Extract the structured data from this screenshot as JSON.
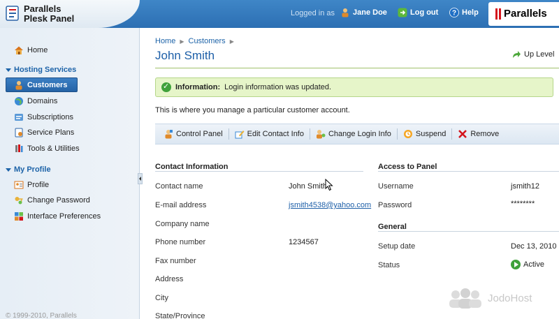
{
  "header": {
    "logo_line1": "Parallels",
    "logo_line2": "Plesk Panel",
    "logged_in_as": "Logged in as",
    "user_name": "Jane Doe",
    "logout_label": "Log out",
    "help_label": "Help",
    "brand": "Parallels"
  },
  "sidebar": {
    "home": "Home",
    "hosting_section": "Hosting Services",
    "hosting_items": [
      "Customers",
      "Domains",
      "Subscriptions",
      "Service Plans",
      "Tools & Utilities"
    ],
    "profile_section": "My Profile",
    "profile_items": [
      "Profile",
      "Change Password",
      "Interface Preferences"
    ],
    "copyright": "© 1999-2010, Parallels"
  },
  "breadcrumb": [
    "Home",
    "Customers"
  ],
  "page_title": "John Smith",
  "up_level": "Up Level",
  "info": {
    "label": "Information:",
    "text": "Login information was updated."
  },
  "description": "This is where you manage a particular customer account.",
  "toolbar": {
    "control_panel": "Control Panel",
    "edit_contact": "Edit Contact Info",
    "change_login": "Change Login Info",
    "suspend": "Suspend",
    "remove": "Remove"
  },
  "contact": {
    "title": "Contact Information",
    "rows": [
      {
        "label": "Contact name",
        "value": "John Smith"
      },
      {
        "label": "E-mail address",
        "value": "jsmith4538@yahoo.com"
      },
      {
        "label": "Company name",
        "value": ""
      },
      {
        "label": "Phone number",
        "value": "1234567"
      },
      {
        "label": "Fax number",
        "value": ""
      },
      {
        "label": "Address",
        "value": ""
      },
      {
        "label": "City",
        "value": ""
      },
      {
        "label": "State/Province",
        "value": ""
      }
    ]
  },
  "access": {
    "title": "Access to Panel",
    "username_label": "Username",
    "username_value": "jsmith12",
    "password_label": "Password",
    "password_value": "********"
  },
  "general": {
    "title": "General",
    "setup_label": "Setup date",
    "setup_value": "Dec 13, 2010",
    "status_label": "Status",
    "status_value": "Active"
  },
  "watermark": "JodoHost",
  "colors": {
    "header_blue": "#2c6fb3",
    "accent_blue": "#1d5fa8",
    "info_green": "#e6f5c9",
    "status_green": "#3fa13a"
  }
}
